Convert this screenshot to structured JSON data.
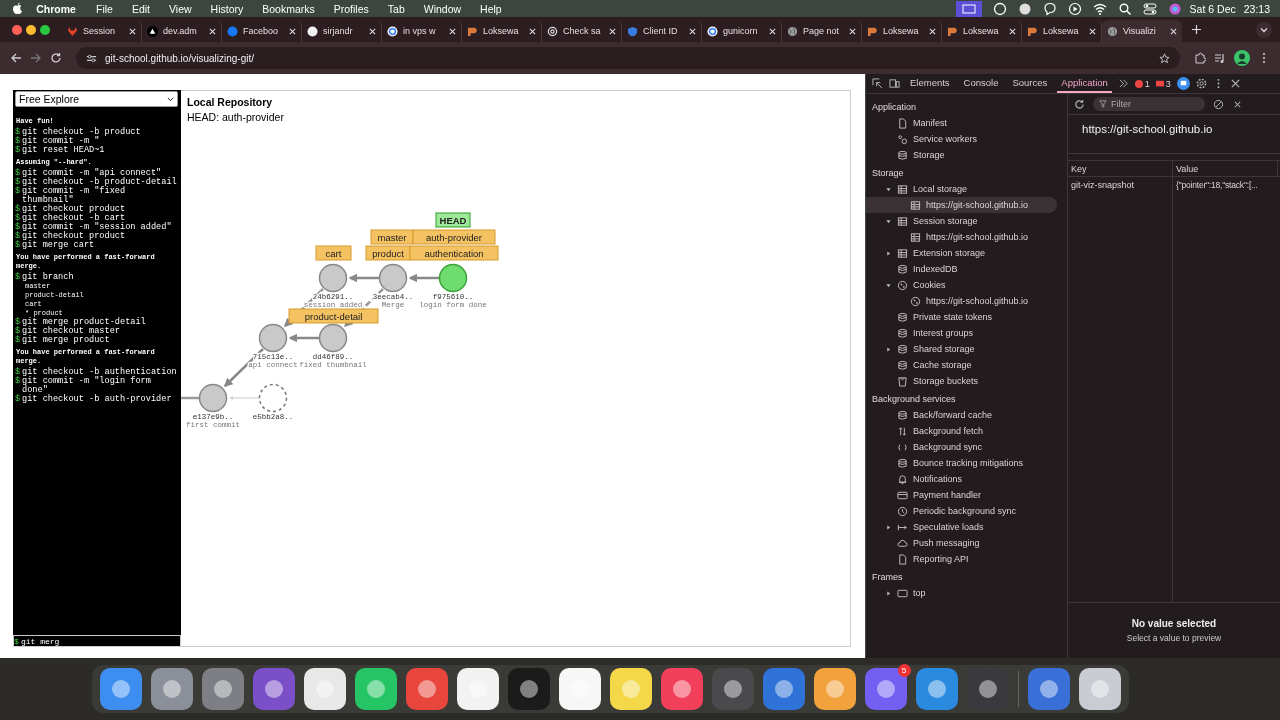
{
  "menu_bar": {
    "app": "Chrome",
    "menus": [
      "File",
      "Edit",
      "View",
      "History",
      "Bookmarks",
      "Profiles",
      "Tab",
      "Window",
      "Help"
    ],
    "date": "Sat 6 Dec",
    "time": "23:13"
  },
  "browser": {
    "tabs": [
      {
        "title": "Session",
        "kind": "fox",
        "selected": false
      },
      {
        "title": "dev.adm",
        "kind": "triangle",
        "selected": false
      },
      {
        "title": "Faceboo",
        "kind": "disc",
        "color": "#1877f2",
        "selected": false
      },
      {
        "title": "sirjandr",
        "kind": "disc",
        "color": "#f0f0f0",
        "selected": false
      },
      {
        "title": "in vps w",
        "kind": "ring",
        "selected": false
      },
      {
        "title": "Loksewa",
        "kind": "flag",
        "selected": false
      },
      {
        "title": "Check sa",
        "kind": "knot",
        "selected": false
      },
      {
        "title": "Client ID",
        "kind": "shield",
        "selected": false
      },
      {
        "title": "gunicorn",
        "kind": "ring",
        "selected": false
      },
      {
        "title": "Page not",
        "kind": "globe",
        "selected": false
      },
      {
        "title": "Loksewa",
        "kind": "flag",
        "selected": false
      },
      {
        "title": "Loksewa",
        "kind": "flag",
        "selected": false
      },
      {
        "title": "Loksewa",
        "kind": "flag",
        "selected": false
      },
      {
        "title": "Visualizi",
        "kind": "globe",
        "selected": true
      }
    ],
    "url": "git-school.github.io/visualizing-git/"
  },
  "page": {
    "mode_select": "Free Explore",
    "terminal": [
      {
        "kind": "info",
        "text": "Have fun!"
      },
      {
        "kind": "cmd",
        "prompt": "$",
        "text": "git checkout -b product"
      },
      {
        "kind": "cmd",
        "prompt": "$",
        "text": "git commit -m \""
      },
      {
        "kind": "cmd",
        "prompt": "$",
        "text": "git reset HEAD~1"
      },
      {
        "kind": "info",
        "text": "Assuming \"--hard\"."
      },
      {
        "kind": "cmd",
        "prompt": "$",
        "text": "git commit -m \"api connect\""
      },
      {
        "kind": "cmd",
        "prompt": "$",
        "text": "git checkout -b product-detail"
      },
      {
        "kind": "cmd",
        "prompt": "$",
        "text": "git commit -m \"fixed thumbnail\""
      },
      {
        "kind": "cmd",
        "prompt": "$",
        "text": "git checkout product"
      },
      {
        "kind": "cmd",
        "prompt": "$",
        "text": "git checkout -b cart"
      },
      {
        "kind": "cmd",
        "prompt": "$",
        "text": "git commit -m \"session added\""
      },
      {
        "kind": "cmd",
        "prompt": "$",
        "text": "git checkout product"
      },
      {
        "kind": "cmd",
        "prompt": "$",
        "text": "git merge cart"
      },
      {
        "kind": "info",
        "text": "You have performed a fast-forward merge."
      },
      {
        "kind": "cmd",
        "prompt": "$",
        "text": "git branch"
      },
      {
        "kind": "output",
        "text": "master"
      },
      {
        "kind": "output",
        "text": "product-detail"
      },
      {
        "kind": "output",
        "text": "cart"
      },
      {
        "kind": "output",
        "text": "* product"
      },
      {
        "kind": "cmd",
        "prompt": "$",
        "text": "git merge product-detail"
      },
      {
        "kind": "cmd",
        "prompt": "$",
        "text": "git checkout master"
      },
      {
        "kind": "cmd",
        "prompt": "$",
        "text": "git merge product"
      },
      {
        "kind": "info",
        "text": "You have performed a fast-forward merge."
      },
      {
        "kind": "cmd",
        "prompt": "$",
        "text": "git checkout -b authentication"
      },
      {
        "kind": "cmd",
        "prompt": "$",
        "text": "git commit -m \"login form done\""
      },
      {
        "kind": "cmd",
        "prompt": "$",
        "text": "git checkout -b auth-provider"
      }
    ],
    "input": {
      "prompt": "$",
      "value": "git merg"
    },
    "graph": {
      "title": "Local Repository",
      "head": "HEAD: auth-provider",
      "commits": [
        {
          "hash": "24b6291..",
          "message": "session added",
          "kind": "commit"
        },
        {
          "hash": "3eecab4..",
          "message": "Merge",
          "kind": "commit"
        },
        {
          "hash": "f975610..",
          "message": "login form done",
          "kind": "current"
        },
        {
          "hash": "715c13e..",
          "message": "api connect",
          "kind": "commit"
        },
        {
          "hash": "dd46f89..",
          "message": "fixed thumbnail",
          "kind": "commit"
        },
        {
          "hash": "e137e9b..",
          "message": "first commit",
          "kind": "commit"
        },
        {
          "hash": "e5bb2a8..",
          "kind": "ghost"
        }
      ],
      "labels": [
        {
          "text": "HEAD",
          "kind": "head"
        },
        {
          "text": "master",
          "kind": "branch"
        },
        {
          "text": "auth-provider",
          "kind": "branch"
        },
        {
          "text": "cart",
          "kind": "branch"
        },
        {
          "text": "product",
          "kind": "branch"
        },
        {
          "text": "authentication",
          "kind": "branch"
        },
        {
          "text": "product-detail",
          "kind": "branch"
        }
      ]
    }
  },
  "devtools": {
    "tabs": [
      {
        "label": "Elements",
        "selected": false
      },
      {
        "label": "Console",
        "selected": false
      },
      {
        "label": "Sources",
        "selected": false
      },
      {
        "label": "Application",
        "selected": true
      }
    ],
    "errors": "1",
    "warnings": "3",
    "sections": [
      {
        "title": "Application",
        "items": [
          {
            "label": "Manifest",
            "kind": "file",
            "selected": false
          },
          {
            "label": "Service workers",
            "kind": "gears",
            "selected": false
          },
          {
            "label": "Storage",
            "kind": "db",
            "selected": false
          }
        ]
      },
      {
        "title": "Storage",
        "items": [
          {
            "label": "Local storage",
            "kind": "table",
            "selected": false,
            "expanded": true,
            "children": [
              {
                "label": "https://git-school.github.io",
                "kind": "table",
                "selected": true
              }
            ]
          },
          {
            "label": "Session storage",
            "kind": "table",
            "selected": false,
            "expanded": true,
            "children": [
              {
                "label": "https://git-school.github.io",
                "kind": "table",
                "selected": false
              }
            ]
          },
          {
            "label": "Extension storage",
            "kind": "table",
            "selected": false,
            "expanded": false
          },
          {
            "label": "IndexedDB",
            "kind": "db",
            "selected": false
          },
          {
            "label": "Cookies",
            "kind": "cookie",
            "selected": false,
            "expanded": true,
            "children": [
              {
                "label": "https://git-school.github.io",
                "kind": "cookie",
                "selected": false
              }
            ]
          },
          {
            "label": "Private state tokens",
            "kind": "db",
            "selected": false
          },
          {
            "label": "Interest groups",
            "kind": "db",
            "selected": false
          },
          {
            "label": "Shared storage",
            "kind": "db",
            "selected": false,
            "expanded": false
          },
          {
            "label": "Cache storage",
            "kind": "db",
            "selected": false
          },
          {
            "label": "Storage buckets",
            "kind": "bucket",
            "selected": false
          }
        ]
      },
      {
        "title": "Background services",
        "items": [
          {
            "label": "Back/forward cache",
            "kind": "db",
            "selected": false
          },
          {
            "label": "Background fetch",
            "kind": "updown",
            "selected": false
          },
          {
            "label": "Background sync",
            "kind": "sync",
            "selected": false
          },
          {
            "label": "Bounce tracking mitigations",
            "kind": "db",
            "selected": false
          },
          {
            "label": "Notifications",
            "kind": "bell",
            "selected": false
          },
          {
            "label": "Payment handler",
            "kind": "card",
            "selected": false
          },
          {
            "label": "Periodic background sync",
            "kind": "clock",
            "selected": false
          },
          {
            "label": "Speculative loads",
            "kind": "arrow",
            "selected": false,
            "expanded": false
          },
          {
            "label": "Push messaging",
            "kind": "cloud",
            "selected": false
          },
          {
            "label": "Reporting API",
            "kind": "file",
            "selected": false
          }
        ]
      },
      {
        "title": "Frames",
        "items": [
          {
            "label": "top",
            "kind": "frame",
            "selected": false,
            "expanded": false
          }
        ]
      }
    ],
    "filter_placeholder": "Filter",
    "origin": "https://git-school.github.io",
    "columns": [
      "Key",
      "Value"
    ],
    "rows": [
      {
        "key": "git-viz-snapshot",
        "value": "{\"pointer\":18,\"stack\":[..."
      }
    ],
    "empty_title": "No value selected",
    "empty_hint": "Select a value to preview"
  },
  "dock": {
    "items": [
      {
        "color": "#3d8ef0"
      },
      {
        "color": "#8a8f99"
      },
      {
        "color": "#7d7f85"
      },
      {
        "color": "#7b4fc8"
      },
      {
        "color": "#e8e8e8"
      },
      {
        "color": "#25c565"
      },
      {
        "color": "#e8453c"
      },
      {
        "color": "#f2f2f2"
      },
      {
        "color": "#1b1b1b"
      },
      {
        "color": "#f7f7f7"
      },
      {
        "color": "#f5d74a"
      },
      {
        "color": "#f2405a"
      },
      {
        "color": "#4a4a4d"
      },
      {
        "color": "#2f72d8"
      },
      {
        "color": "#f2a23c"
      },
      {
        "color": "#7360f2",
        "badge": "5"
      },
      {
        "color": "#2a8ae0"
      },
      {
        "color": "#3a3a3e"
      },
      {
        "color": "#3a6fd8"
      },
      {
        "color": "#c9ccd2"
      }
    ]
  }
}
